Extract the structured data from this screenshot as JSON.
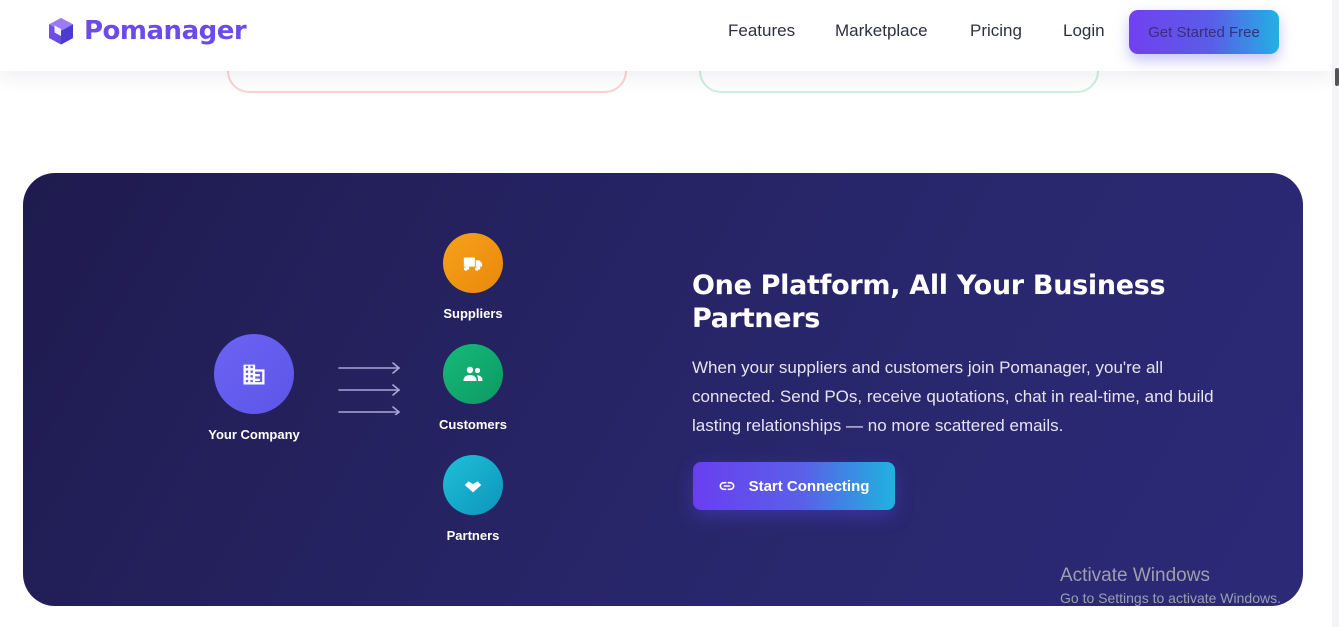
{
  "brand": {
    "name": "Pomanager",
    "logo_icon": "cube-icon",
    "color": "#6d4bea"
  },
  "nav": {
    "features": "Features",
    "marketplace": "Marketplace",
    "pricing": "Pricing",
    "login": "Login",
    "cta": "Get Started Free"
  },
  "network": {
    "center": {
      "label": "Your Company",
      "icon": "building-icon",
      "color": "#6d63f5"
    },
    "nodes": [
      {
        "label": "Suppliers",
        "icon": "truck-icon",
        "color": "#f7a21b"
      },
      {
        "label": "Customers",
        "icon": "users-icon",
        "color": "#16b97a"
      },
      {
        "label": "Partners",
        "icon": "handshake-icon",
        "color": "#1ec0d8"
      }
    ]
  },
  "section": {
    "headline_line1": "One Platform, All Your Business",
    "headline_line2": "Partners",
    "body": "When your suppliers and customers join Pomanager, you're all connected. Send POs, receive quotations, chat in real-time, and build lasting relationships — no more scattered emails.",
    "button_label": "Start Connecting",
    "button_icon": "link-icon"
  },
  "os_watermark": {
    "title": "Activate Windows",
    "subtitle": "Go to Settings to activate Windows."
  }
}
